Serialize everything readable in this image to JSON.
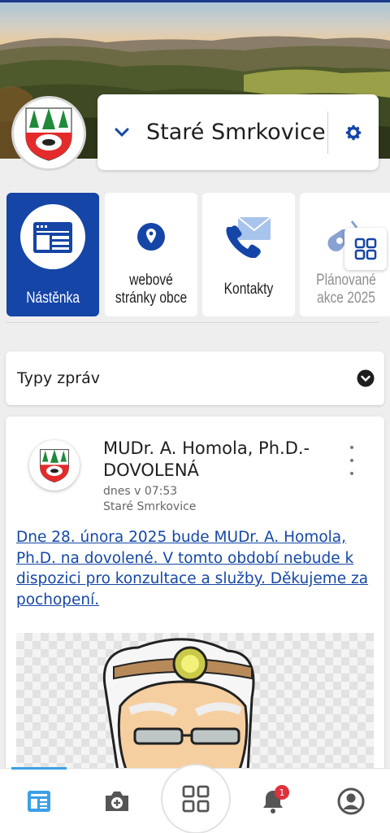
{
  "app": {
    "accent_color": "#1545a6",
    "active_tile_color": "#1545a6"
  },
  "header": {
    "village_name": "Staré Smrkovice",
    "crest_icon": "village-crest-icon",
    "dropdown_icon": "chevron-down-icon",
    "settings_icon": "gear-icon"
  },
  "tiles": [
    {
      "label": "Nástěnka",
      "icon": "newsboard-icon",
      "active": true
    },
    {
      "label": "webové stránky obce",
      "icon": "location-pin-icon",
      "active": false
    },
    {
      "label": "Kontakty",
      "icon": "phone-mail-icon",
      "active": false
    },
    {
      "label": "Plánované akce 2025",
      "icon": "whistle-icon",
      "active": false
    }
  ],
  "filter": {
    "label": "Typy zpráv",
    "icon": "chevron-down-circle-icon"
  },
  "post": {
    "title": "MUDr. A. Homola, Ph.D.- DOVOLENÁ",
    "time": "dnes v 07:53",
    "place": "Staré Smrkovice",
    "body": "Dne  28. února 2025 bude MUDr. A. Homola, Ph.D. na dovolené. V tomto období nebude k dispozici pro konzultace a služby. Děkujeme za pochopení.",
    "image": "doctor-illustration"
  },
  "bottom_nav": {
    "items": [
      {
        "name": "news",
        "icon": "news-icon",
        "active": true
      },
      {
        "name": "camera",
        "icon": "camera-add-icon"
      },
      {
        "name": "menu",
        "icon": "grid-icon"
      },
      {
        "name": "notifications",
        "icon": "bell-icon",
        "badge": "1"
      },
      {
        "name": "profile",
        "icon": "user-icon"
      }
    ]
  }
}
